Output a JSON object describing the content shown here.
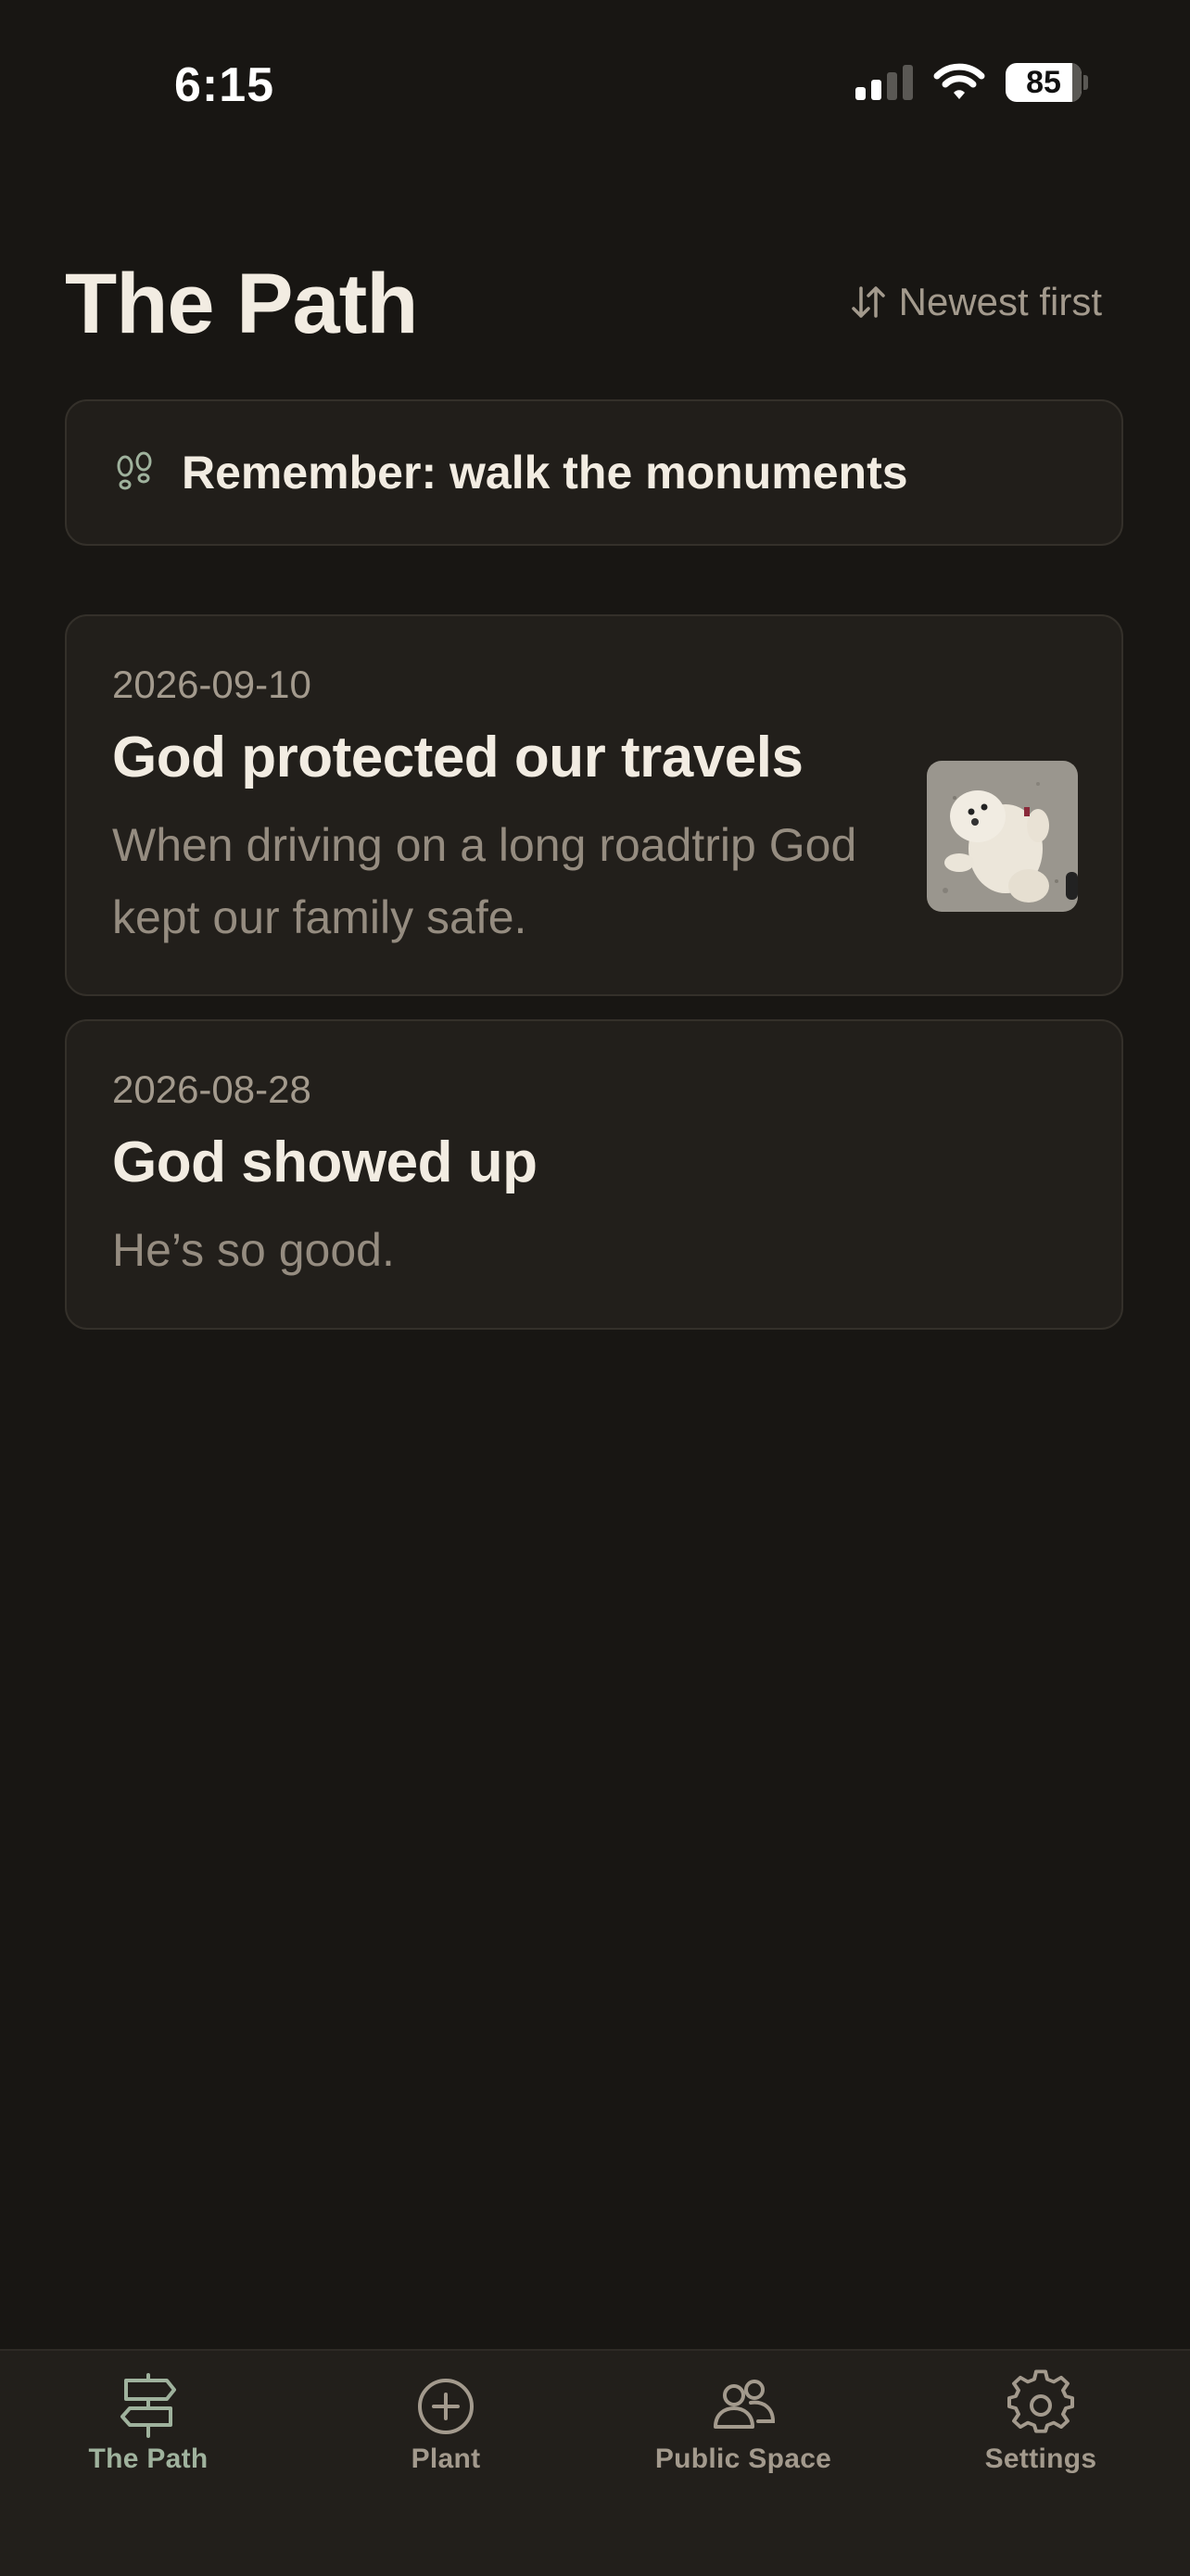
{
  "status_bar": {
    "time": "6:15",
    "battery": "85"
  },
  "header": {
    "title": "The Path",
    "sort_label": "Newest first"
  },
  "reminder": {
    "text": "Remember: walk the monuments",
    "icon": "footprints-icon"
  },
  "entries": [
    {
      "date": "2026-09-10",
      "title": "God protected our travels",
      "body": "When driving on a long roadtrip God kept our family safe.",
      "has_photo": true
    },
    {
      "date": "2026-08-28",
      "title": "God showed up",
      "body": "He’s so good.",
      "has_photo": false
    }
  ],
  "tab_bar": {
    "tabs": [
      {
        "label": "The Path",
        "icon": "signpost-icon",
        "active": true
      },
      {
        "label": "Plant",
        "icon": "plus-circle-icon",
        "active": false
      },
      {
        "label": "Public Space",
        "icon": "people-icon",
        "active": false
      },
      {
        "label": "Settings",
        "icon": "gear-icon",
        "active": false
      }
    ]
  },
  "colors": {
    "background": "#181613",
    "card": "#221f1b",
    "text_primary": "#f2ece2",
    "text_muted": "#a39a8d",
    "accent_green": "#9fb29d"
  }
}
